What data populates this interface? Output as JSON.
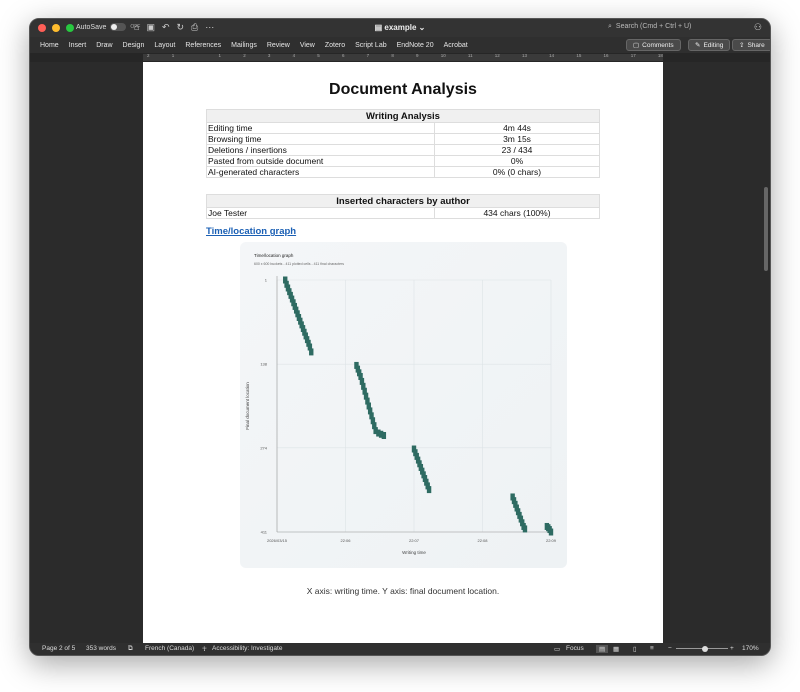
{
  "titlebar": {
    "autosave_label": "AutoSave",
    "autosave_state": "OFF",
    "doc_name": "example",
    "search_placeholder": "Search (Cmd + Ctrl + U)"
  },
  "ribbon": {
    "tabs": [
      "Home",
      "Insert",
      "Draw",
      "Design",
      "Layout",
      "References",
      "Mailings",
      "Review",
      "View",
      "Zotero",
      "Script Lab",
      "EndNote 20",
      "Acrobat"
    ],
    "comments_label": "Comments",
    "editing_label": "Editing",
    "share_label": "Share"
  },
  "ruler": {
    "ticks": [
      "2",
      "1",
      "",
      "1",
      "2",
      "3",
      "4",
      "5",
      "6",
      "7",
      "8",
      "9",
      "10",
      "11",
      "12",
      "13",
      "14",
      "15",
      "16",
      "17",
      "18"
    ]
  },
  "document": {
    "title": "Document Analysis",
    "writing_analysis": {
      "header": "Writing Analysis",
      "rows": [
        {
          "label": "Editing time",
          "value": "4m 44s"
        },
        {
          "label": "Browsing time",
          "value": "3m 15s"
        },
        {
          "label": "Deletions / insertions",
          "value": "23 / 434"
        },
        {
          "label": "Pasted from outside document",
          "value": "0%"
        },
        {
          "label": "AI-generated characters",
          "value": "0% (0 chars)"
        }
      ]
    },
    "authors": {
      "header": "Inserted characters by author",
      "rows": [
        {
          "label": "Joe Tester",
          "value": "434 chars (100%)"
        }
      ]
    },
    "graph_link": "Time/location graph",
    "caption": "X axis: writing time. Y axis: final document location."
  },
  "chart_data": {
    "type": "scatter",
    "title": "Time/location graph",
    "subtitle": "600 x 600 buckets - 411 plotted cells - 411 final characters",
    "xlabel": "Writing time",
    "ylabel": "Final document location",
    "x_tick_labels": [
      "2026/03/15",
      "22:06",
      "22:07",
      "22:08",
      "22:09"
    ],
    "y_tick_labels": [
      "1",
      "138",
      "274",
      "411"
    ],
    "ylim": [
      1,
      411
    ],
    "xlim": [
      0,
      1
    ],
    "grid": true,
    "marker_color": "#2e6b62",
    "series": [
      {
        "x": [
          0.03,
          0.035,
          0.04,
          0.045,
          0.05,
          0.055,
          0.06,
          0.065,
          0.07,
          0.075,
          0.08,
          0.085,
          0.09,
          0.095,
          0.1,
          0.105,
          0.11,
          0.115,
          0.12,
          0.125,
          0.29,
          0.295,
          0.3,
          0.305,
          0.31,
          0.315,
          0.32,
          0.325,
          0.33,
          0.335,
          0.34,
          0.345,
          0.35,
          0.355,
          0.36,
          0.37,
          0.38,
          0.39,
          0.5,
          0.505,
          0.51,
          0.515,
          0.52,
          0.525,
          0.53,
          0.535,
          0.54,
          0.545,
          0.55,
          0.555,
          0.86,
          0.865,
          0.87,
          0.875,
          0.88,
          0.885,
          0.89,
          0.895,
          0.9,
          0.905,
          0.985,
          0.99,
          0.995,
          1.0
        ],
        "y": [
          1,
          8,
          14,
          20,
          26,
          32,
          38,
          44,
          50,
          56,
          62,
          68,
          74,
          80,
          86,
          92,
          98,
          104,
          110,
          118,
          140,
          146,
          152,
          158,
          166,
          174,
          182,
          190,
          198,
          206,
          214,
          222,
          230,
          238,
          246,
          250,
          252,
          254,
          276,
          282,
          288,
          294,
          300,
          306,
          312,
          318,
          324,
          330,
          336,
          342,
          354,
          360,
          366,
          372,
          378,
          384,
          390,
          396,
          402,
          406,
          402,
          404,
          407,
          411
        ]
      }
    ]
  },
  "statusbar": {
    "page": "Page 2 of 5",
    "words": "353 words",
    "language": "French (Canada)",
    "accessibility": "Accessibility: Investigate",
    "focus": "Focus",
    "zoom": "170%"
  }
}
